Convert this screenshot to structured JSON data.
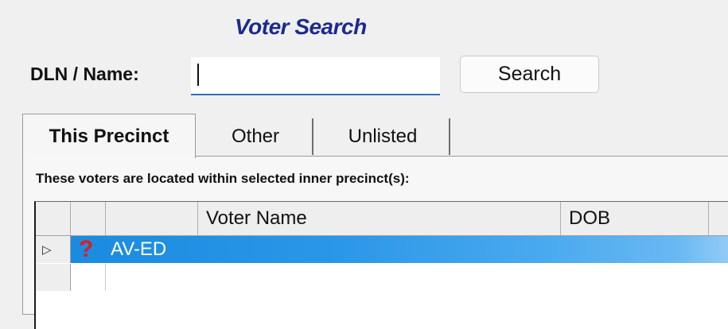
{
  "header": {
    "title": "Voter Search"
  },
  "search": {
    "label": "DLN / Name:",
    "value": "",
    "placeholder": "",
    "button_label": "Search"
  },
  "tabs": [
    {
      "label": "This Precinct",
      "active": true
    },
    {
      "label": "Other",
      "active": false
    },
    {
      "label": "Unlisted",
      "active": false
    }
  ],
  "panel": {
    "caption": "These voters are located within selected inner precinct(s):"
  },
  "grid": {
    "columns": [
      "",
      "",
      "Voter Name",
      "DOB"
    ],
    "rows": [
      {
        "selected": true,
        "status_icon": "question-mark-icon",
        "code": "AV-ED",
        "voter_name": "",
        "dob": ""
      }
    ]
  },
  "colors": {
    "accent": "#1c2a8f",
    "selection": "#1a8be0",
    "status_red": "#e11b1b"
  }
}
